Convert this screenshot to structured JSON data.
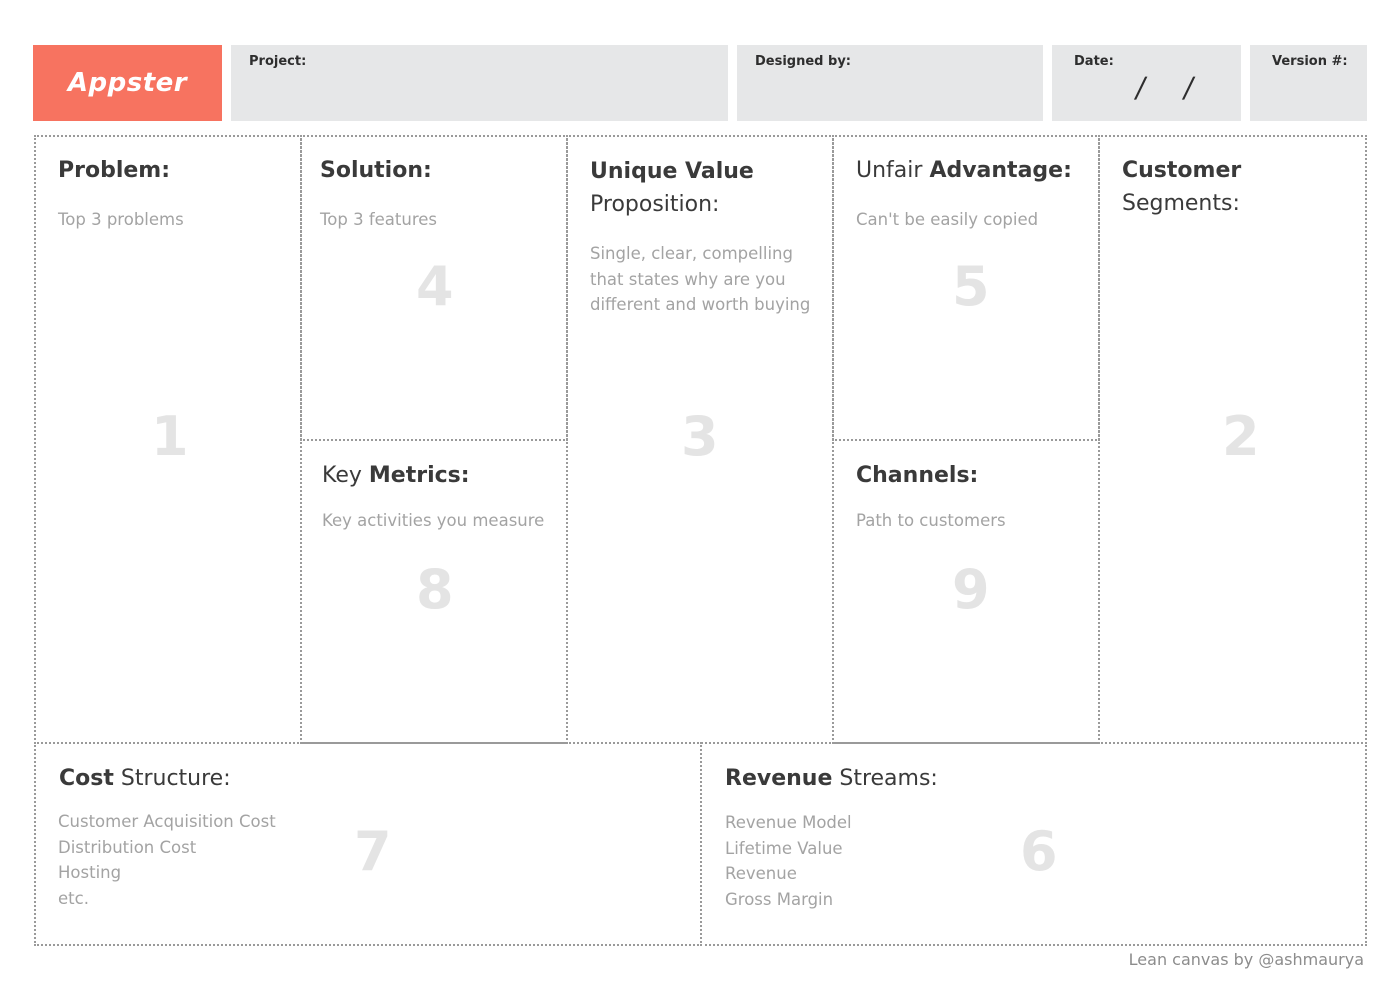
{
  "header": {
    "logo": "Appster",
    "project_label": "Project:",
    "designed_label": "Designed by:",
    "date_label": "Date:",
    "date_slash_1": "/",
    "date_slash_2": "/",
    "version_label": "Version #:"
  },
  "colors": {
    "brand": "#f77360",
    "header_bg": "#e6e7e8"
  },
  "canvas": {
    "problem": {
      "title_bold": "Problem:",
      "hint": "Top 3 problems",
      "number": "1"
    },
    "solution": {
      "title_bold": "Solution:",
      "hint": "Top 3 features",
      "number": "4"
    },
    "uvp": {
      "title_bold": "Unique Value",
      "title_rest": "Proposition:",
      "hint": "Single, clear, compelling\nthat states why are you\ndifferent and worth buying",
      "number": "3"
    },
    "unfair": {
      "title_pre": "Unfair ",
      "title_bold": "Advantage:",
      "hint": "Can't be easily copied",
      "number": "5"
    },
    "segments": {
      "title_bold": "Customer",
      "title_rest": " Segments:",
      "number": "2"
    },
    "metrics": {
      "title_pre": "Key ",
      "title_bold": "Metrics:",
      "hint": "Key activities you measure",
      "number": "8"
    },
    "channels": {
      "title_bold": "Channels:",
      "hint": "Path to customers",
      "number": "9"
    },
    "cost": {
      "title_bold": "Cost",
      "title_rest": " Structure:",
      "hint": "Customer Acquisition Cost\nDistribution Cost\nHosting\netc.",
      "number": "7"
    },
    "revenue": {
      "title_bold": "Revenue",
      "title_rest": " Streams:",
      "hint": "Revenue Model\nLifetime Value\nRevenue\nGross Margin",
      "number": "6"
    }
  },
  "footer": "Lean canvas by @ashmaurya"
}
